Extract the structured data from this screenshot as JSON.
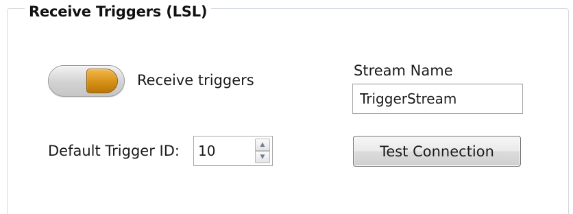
{
  "group": {
    "title": "Receive Triggers (LSL)"
  },
  "receive_toggle": {
    "label": "Receive triggers",
    "state": "on",
    "accent_color": "#d28e12"
  },
  "stream_name": {
    "label": "Stream Name",
    "value": "TriggerStream"
  },
  "default_trigger": {
    "label": "Default Trigger ID:",
    "value": "10",
    "up_icon": "spin-up-icon",
    "down_icon": "spin-down-icon"
  },
  "test_connection": {
    "label": "Test Connection"
  }
}
